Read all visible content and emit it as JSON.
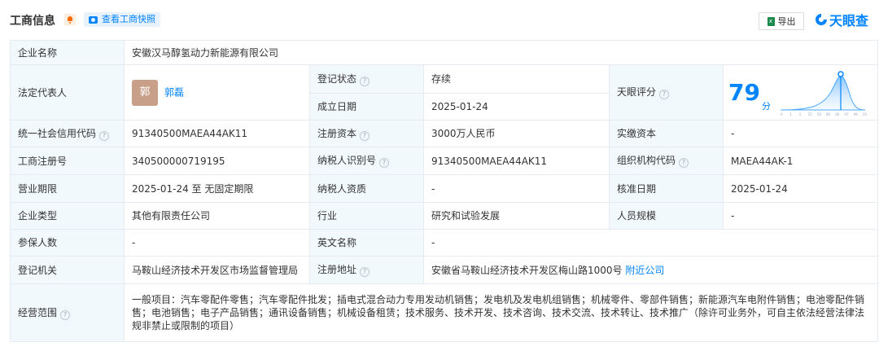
{
  "header": {
    "title": "工商信息",
    "snapshot_label": "查看工商快照",
    "export_label": "导出",
    "brand": "天眼查"
  },
  "rows": {
    "company_name": {
      "label": "企业名称",
      "value": "安徽汉马醇氢动力新能源有限公司"
    },
    "legal_rep": {
      "label": "法定代表人",
      "avatar": "郭",
      "name": "郭磊"
    },
    "reg_status": {
      "label": "登记状态",
      "value": "存续"
    },
    "est_date": {
      "label": "成立日期",
      "value": "2025-01-24"
    },
    "tianyan_score": {
      "label": "天眼评分",
      "value": "79",
      "unit": "分",
      "axis_ticks": [
        "0",
        "1",
        "3",
        "15",
        "50",
        "80",
        "90",
        "97",
        "99",
        "100"
      ],
      "marker_color": "#0084ff"
    },
    "credit_code": {
      "label": "统一社会信用代码",
      "value": "91340500MAEA44AK11"
    },
    "reg_capital": {
      "label": "注册资本",
      "value": "3000万人民币"
    },
    "paid_capital": {
      "label": "实缴资本",
      "value": "-"
    },
    "reg_number": {
      "label": "工商注册号",
      "value": "340500000719195"
    },
    "taxpayer_id": {
      "label": "纳税人识别号",
      "value": "91340500MAEA44AK11"
    },
    "org_code": {
      "label": "组织机构代码",
      "value": "MAEA44AK-1"
    },
    "business_term": {
      "label": "营业期限",
      "value": "2025-01-24 至 无固定期限"
    },
    "taxpayer_qual": {
      "label": "纳税人资质",
      "value": "-"
    },
    "approval_date": {
      "label": "核准日期",
      "value": "2025-01-24"
    },
    "company_type": {
      "label": "企业类型",
      "value": "其他有限责任公司"
    },
    "industry": {
      "label": "行业",
      "value": "研究和试验发展"
    },
    "staff_size": {
      "label": "人员规模",
      "value": "-"
    },
    "insured": {
      "label": "参保人数",
      "value": "-"
    },
    "english_name": {
      "label": "英文名称",
      "value": "-"
    },
    "reg_authority": {
      "label": "登记机关",
      "value": "马鞍山经济技术开发区市场监督管理局"
    },
    "reg_address": {
      "label": "注册地址",
      "value": "安徽省马鞍山经济技术开发区梅山路1000号",
      "link": "附近公司"
    },
    "business_scope": {
      "label": "经营范围",
      "value": "一般项目：汽车零配件零售；汽车零配件批发；插电式混合动力专用发动机销售；发电机及发电机组销售；机械零件、零部件销售；新能源汽车电附件销售；电池零配件销售；电池销售；电子产品销售；通讯设备销售；机械设备租赁；技术服务、技术开发、技术咨询、技术交流、技术转让、技术推广（除许可业务外，可自主依法经营法律法规非禁止或限制的项目）"
    }
  }
}
